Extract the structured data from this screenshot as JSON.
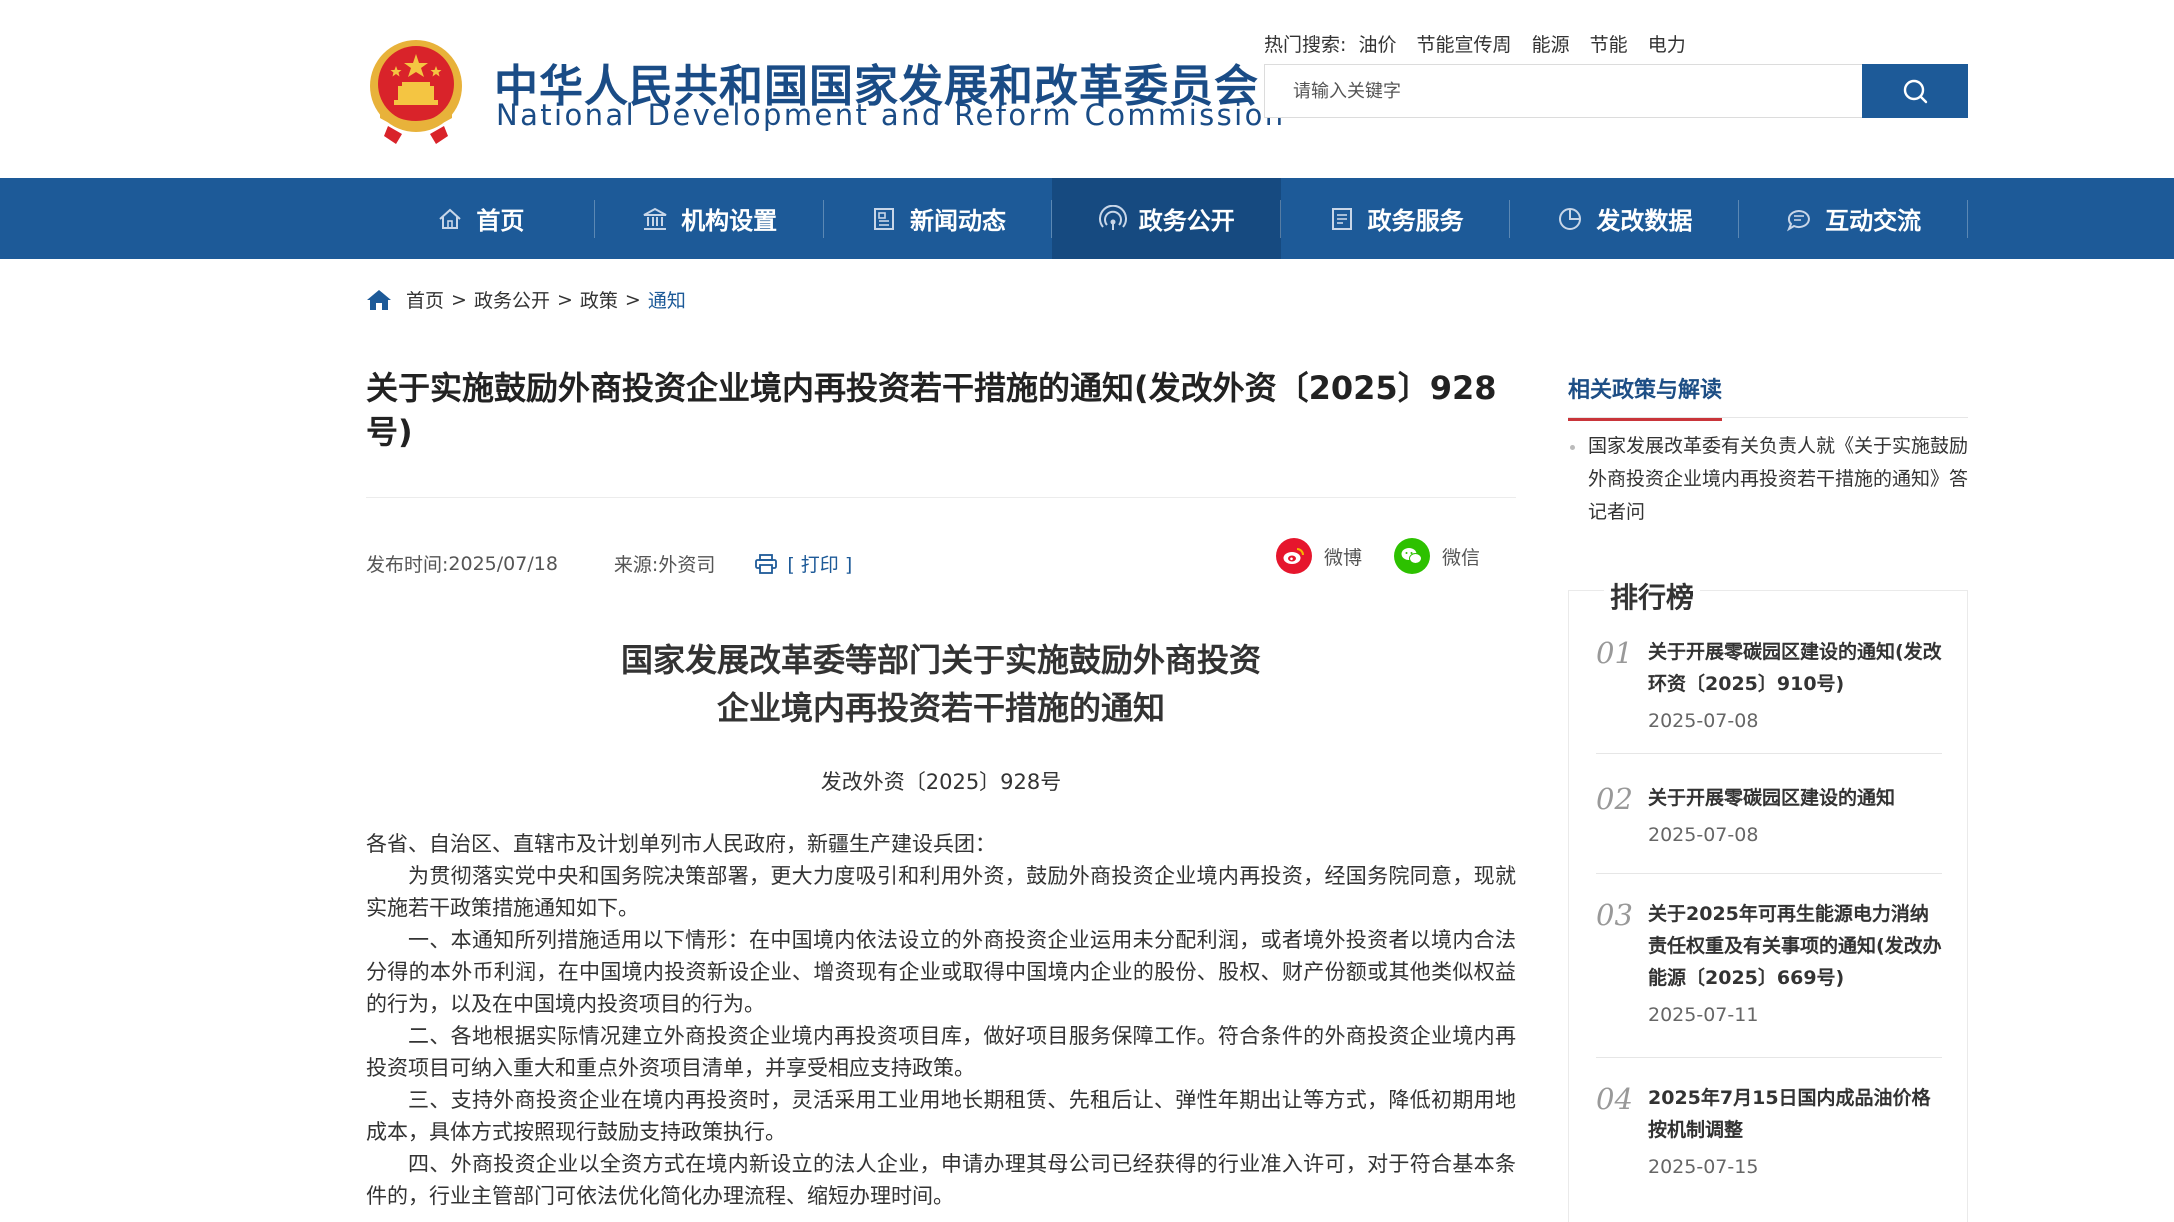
{
  "header": {
    "title_cn": "中华人民共和国国家发展和改革委员会",
    "title_en": "National Development and Reform Commission",
    "hot_label": "热门搜索:",
    "hot_terms": [
      "油价",
      "节能宣传周",
      "能源",
      "节能",
      "电力"
    ],
    "search_placeholder": "请输入关键字",
    "colors": {
      "primary": "#1d5a98",
      "accent_red": "#c9353a"
    }
  },
  "nav": {
    "items": [
      {
        "label": "首页",
        "icon": "home-icon"
      },
      {
        "label": "机构设置",
        "icon": "building-icon"
      },
      {
        "label": "新闻动态",
        "icon": "news-icon"
      },
      {
        "label": "政务公开",
        "icon": "broadcast-icon",
        "active": true
      },
      {
        "label": "政务服务",
        "icon": "document-icon"
      },
      {
        "label": "发改数据",
        "icon": "pie-chart-icon"
      },
      {
        "label": "互动交流",
        "icon": "chat-icon"
      }
    ]
  },
  "breadcrumb": [
    "首页",
    "政务公开",
    "政策",
    "通知"
  ],
  "article": {
    "title": "关于实施鼓励外商投资企业境内再投资若干措施的通知(发改外资〔2025〕928号)",
    "publish_label": "发布时间:",
    "publish_date": "2025/07/18",
    "source_label": "来源:",
    "source": "外资司",
    "print_label": "[ 打印 ]",
    "share_weibo": "微博",
    "share_wechat": "微信",
    "doc_title_line1": "国家发展改革委等部门关于实施鼓励外商投资",
    "doc_title_line2": "企业境内再投资若干措施的通知",
    "doc_number": "发改外资〔2025〕928号",
    "paragraphs": [
      "各省、自治区、直辖市及计划单列市人民政府，新疆生产建设兵团：",
      "为贯彻落实党中央和国务院决策部署，更大力度吸引和利用外资，鼓励外商投资企业境内再投资，经国务院同意，现就实施若干政策措施通知如下。",
      "一、本通知所列措施适用以下情形：在中国境内依法设立的外商投资企业运用未分配利润，或者境外投资者以境内合法分得的本外币利润，在中国境内投资新设企业、增资现有企业或取得中国境内企业的股份、股权、财产份额或其他类似权益的行为，以及在中国境内投资项目的行为。",
      "二、各地根据实际情况建立外商投资企业境内再投资项目库，做好项目服务保障工作。符合条件的外商投资企业境内再投资项目可纳入重大和重点外资项目清单，并享受相应支持政策。",
      "三、支持外商投资企业在境内再投资时，灵活采用工业用地长期租赁、先租后让、弹性年期出让等方式，降低初期用地成本，具体方式按照现行鼓励支持政策执行。",
      "四、外商投资企业以全资方式在境内新设立的法人企业，申请办理其母公司已经获得的行业准入许可，对于符合基本条件的，行业主管部门可依法优化简化办理流程、缩短办理时间。"
    ]
  },
  "sidebar": {
    "related_title": "相关政策与解读",
    "related_items": [
      "国家发展改革委有关负责人就《关于实施鼓励外商投资企业境内再投资若干措施的通知》答记者问"
    ],
    "ranking_title": "排行榜",
    "ranking": [
      {
        "num": "01",
        "title": "关于开展零碳园区建设的通知(发改环资〔2025〕910号)",
        "date": "2025-07-08"
      },
      {
        "num": "02",
        "title": "关于开展零碳园区建设的通知",
        "date": "2025-07-08"
      },
      {
        "num": "03",
        "title": "关于2025年可再生能源电力消纳责任权重及有关事项的通知(发改办能源〔2025〕669号)",
        "date": "2025-07-11"
      },
      {
        "num": "04",
        "title": "2025年7月15日国内成品油价格按机制调整",
        "date": "2025-07-15"
      }
    ]
  }
}
